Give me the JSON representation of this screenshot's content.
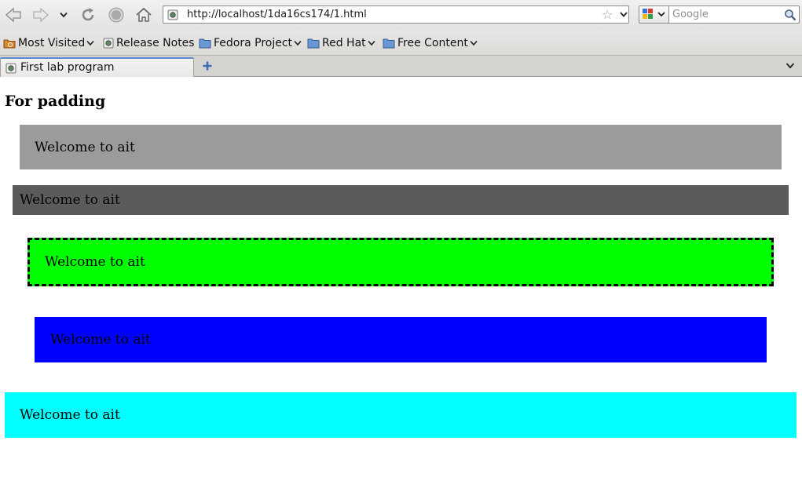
{
  "browser": {
    "url": "http://localhost/1da16cs174/1.html",
    "search_placeholder": "Google",
    "bookmarks": [
      "Most Visited",
      "Release Notes",
      "Fedora Project",
      "Red Hat",
      "Free Content"
    ],
    "tab_title": "First lab program"
  },
  "page": {
    "heading": "For padding",
    "boxes": [
      {
        "text": "Welcome to ait",
        "color": "#9b9b9b"
      },
      {
        "text": "Welcome to ait",
        "color": "#5b5b5b"
      },
      {
        "text": "Welcome to ait",
        "color": "#00ff00",
        "border": "dashed"
      },
      {
        "text": "Welcome to ait",
        "color": "#0000ff"
      },
      {
        "text": "Welcome to ait",
        "color": "#00ffff"
      }
    ]
  },
  "icons": {
    "back": "back-arrow-icon",
    "forward": "forward-arrow-icon",
    "history": "chevron-down-icon",
    "reload": "reload-icon",
    "stop": "stop-icon",
    "home": "home-icon",
    "bookmark_star": "star-icon",
    "search": "magnifier-icon",
    "new_tab": "plus-icon"
  }
}
